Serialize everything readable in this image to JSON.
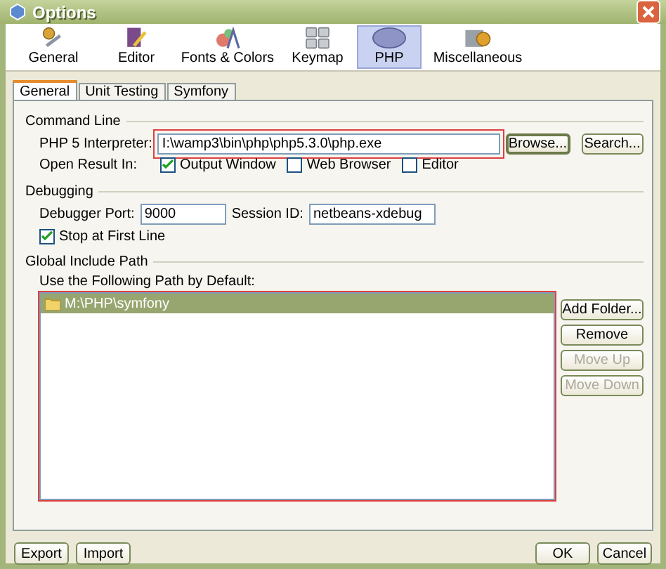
{
  "window": {
    "title": "Options"
  },
  "categories": [
    {
      "label": "General",
      "kind": "general",
      "selected": false
    },
    {
      "label": "Editor",
      "kind": "editor",
      "selected": false
    },
    {
      "label": "Fonts & Colors",
      "kind": "fonts",
      "selected": false
    },
    {
      "label": "Keymap",
      "kind": "keymap",
      "selected": false
    },
    {
      "label": "PHP",
      "kind": "php",
      "selected": true
    },
    {
      "label": "Miscellaneous",
      "kind": "misc",
      "selected": false
    }
  ],
  "tabs": [
    {
      "label": "General",
      "selected": true
    },
    {
      "label": "Unit Testing",
      "selected": false
    },
    {
      "label": "Symfony",
      "selected": false
    }
  ],
  "command_line": {
    "title": "Command Line",
    "interpreter_label": "PHP 5 Interpreter:",
    "interpreter_value": "I:\\wamp3\\bin\\php\\php5.3.0\\php.exe",
    "highlighted": true,
    "buttons": [
      {
        "label": "Browse...",
        "default": true
      },
      {
        "label": "Search...",
        "default": false
      }
    ],
    "open_result_label": "Open Result In:",
    "options": [
      {
        "label": "Output Window",
        "checked": true
      },
      {
        "label": "Web Browser",
        "checked": false
      },
      {
        "label": "Editor",
        "checked": false
      }
    ]
  },
  "debugging": {
    "title": "Debugging",
    "port_label": "Debugger Port:",
    "port_value": "9000",
    "session_label": "Session ID:",
    "session_value": "netbeans-xdebug",
    "stop_label": "Stop at First Line",
    "stop_checked": true
  },
  "include_path": {
    "title": "Global Include Path",
    "list_label": "Use the Following Path by Default:",
    "highlighted": true,
    "paths": [
      {
        "label": "M:\\PHP\\symfony",
        "selected": true
      }
    ],
    "buttons": [
      {
        "label": "Add Folder...",
        "disabled": false
      },
      {
        "label": "Remove",
        "disabled": false
      },
      {
        "label": "Move Up",
        "disabled": true
      },
      {
        "label": "Move Down",
        "disabled": true
      }
    ]
  },
  "footer": {
    "left": [
      {
        "label": "Export"
      },
      {
        "label": "Import"
      }
    ],
    "right": [
      {
        "label": "OK"
      },
      {
        "label": "Cancel"
      }
    ]
  }
}
